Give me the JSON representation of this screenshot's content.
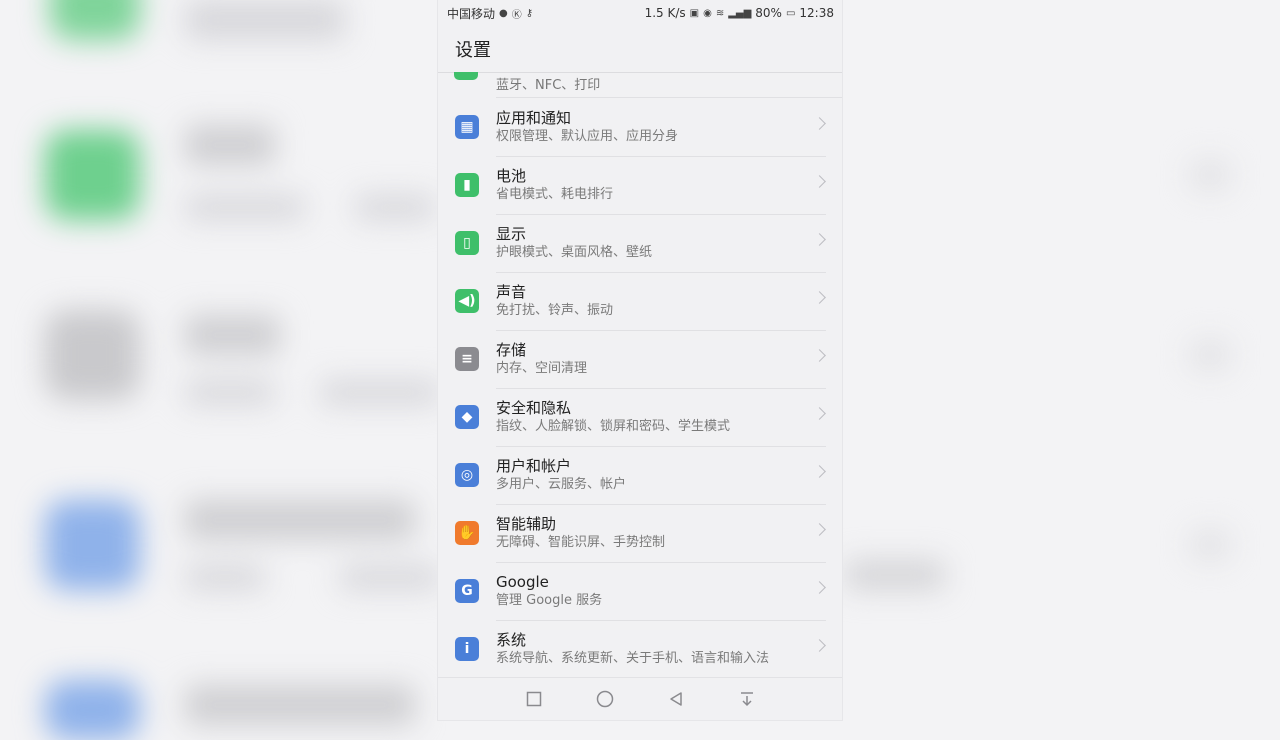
{
  "status_bar": {
    "carrier": "中国移动",
    "speed": "1.5 K/s",
    "battery": "80%",
    "time": "12:38"
  },
  "header": {
    "title": "设置"
  },
  "partial_item": {
    "subtitle": "蓝牙、NFC、打印"
  },
  "items": [
    {
      "title": "应用和通知",
      "subtitle": "权限管理、默认应用、应用分身",
      "icon": "apps-grid-icon",
      "color": "#4a7fd8"
    },
    {
      "title": "电池",
      "subtitle": "省电模式、耗电排行",
      "icon": "battery-icon",
      "color": "#3fbf6a"
    },
    {
      "title": "显示",
      "subtitle": "护眼模式、桌面风格、壁纸",
      "icon": "display-icon",
      "color": "#3fbf6a"
    },
    {
      "title": "声音",
      "subtitle": "免打扰、铃声、振动",
      "icon": "speaker-icon",
      "color": "#3fbf6a"
    },
    {
      "title": "存储",
      "subtitle": "内存、空间清理",
      "icon": "storage-icon",
      "color": "#8b8b90"
    },
    {
      "title": "安全和隐私",
      "subtitle": "指纹、人脸解锁、锁屏和密码、学生模式",
      "icon": "shield-icon",
      "color": "#4a7fd8"
    },
    {
      "title": "用户和帐户",
      "subtitle": "多用户、云服务、帐户",
      "icon": "user-icon",
      "color": "#4a7fd8"
    },
    {
      "title": "智能辅助",
      "subtitle": "无障碍、智能识屏、手势控制",
      "icon": "hand-icon",
      "color": "#f07a2c"
    },
    {
      "title": "Google",
      "subtitle": "管理 Google 服务",
      "icon": "google-icon",
      "color": "#4a7fd8"
    },
    {
      "title": "系统",
      "subtitle": "系统导航、系统更新、关于手机、语言和输入法",
      "icon": "system-info-icon",
      "color": "#4a7fd8"
    }
  ],
  "nav": [
    "recents-button",
    "home-button",
    "back-button",
    "notification-pull-button"
  ]
}
